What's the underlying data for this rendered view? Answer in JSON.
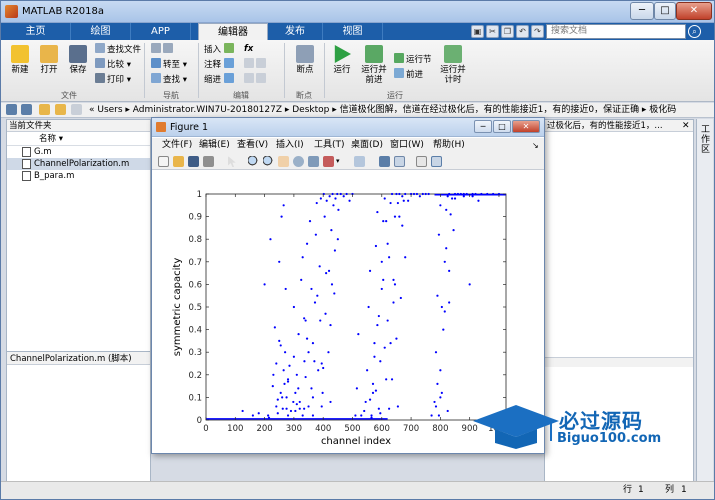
{
  "window": {
    "title": "MATLAB R2018a",
    "min": "─",
    "max": "□",
    "close": "✕"
  },
  "tabs": [
    "主页",
    "绘图",
    "APP",
    "编辑器",
    "发布",
    "视图"
  ],
  "active_tab": "编辑器",
  "search": {
    "placeholder": "搜索文档"
  },
  "ribbon": {
    "file": {
      "new": "新建",
      "open": "打开",
      "save": "保存",
      "find_files": "查找文件",
      "compare": "比较",
      "print": "打印",
      "section": "文件"
    },
    "nav": {
      "goto": "转至",
      "find": "查找",
      "section": "导航"
    },
    "edit": {
      "insert": "插入",
      "comment": "注释",
      "indent": "缩进",
      "fx": "fx",
      "section": "编辑"
    },
    "breakpoints": {
      "label": "断点",
      "section": "断点"
    },
    "run": {
      "run": "运行",
      "run_advance": "运行并前进",
      "run_section": "运行节",
      "advance": "前进",
      "run_time": "运行并计时",
      "section": "运行"
    }
  },
  "address": {
    "path": "« Users ▸ Administrator.WIN7U-20180127Z ▸ Desktop ▸ 信道极化图解，信道在经过极化后，有的性能接近1，有的接近0，保证正确 ▸ 极化码"
  },
  "current_folder": {
    "title": "当前文件夹",
    "name_column": "名称 ▾",
    "files": [
      "G.m",
      "ChannelPolarization.m",
      "B_para.m"
    ],
    "selected": "ChannelPolarization.m",
    "details": "ChannelPolarization.m  (脚本)"
  },
  "editor_tab_text": "过极化后，有的性能接近1，...",
  "workspace_label": "工作区",
  "status": {
    "row_label": "行",
    "row": "1",
    "col_label": "列",
    "col": "1"
  },
  "figure": {
    "title": "Figure 1",
    "menu": [
      "文件(F)",
      "编辑(E)",
      "查看(V)",
      "插入(I)",
      "工具(T)",
      "桌面(D)",
      "窗口(W)",
      "帮助(H)"
    ]
  },
  "chart_data": {
    "type": "scatter",
    "title": "",
    "xlabel": "channel index",
    "ylabel": "symmetric capacity",
    "xlim": [
      0,
      1024
    ],
    "ylim": [
      0,
      1
    ],
    "xticks": [
      0,
      100,
      200,
      300,
      400,
      500,
      600,
      700,
      800,
      900,
      1000
    ],
    "yticks": [
      0,
      0.1,
      0.2,
      0.3,
      0.4,
      0.5,
      0.6,
      0.7,
      0.8,
      0.9,
      1
    ],
    "marker_color": "#0000ff",
    "grid": false,
    "series": [
      {
        "x": [
          125,
          160,
          180,
          200,
          212,
          220,
          228,
          235,
          240,
          245,
          250,
          255,
          258,
          262,
          265,
          268,
          272,
          275,
          280,
          290,
          298,
          305,
          310,
          316,
          320,
          325,
          330,
          336,
          340,
          345,
          350,
          355,
          360,
          365,
          372,
          378,
          383,
          388,
          392,
          398,
          402,
          408,
          412,
          418,
          422,
          428,
          432,
          438,
          442,
          448,
          452,
          460,
          470,
          480,
          490,
          500,
          510,
          515,
          520,
          530,
          540,
          545,
          550,
          555,
          560,
          565,
          570,
          575,
          580,
          585,
          590,
          595,
          600,
          605,
          610,
          615,
          620,
          625,
          630,
          635,
          640,
          645,
          650,
          655,
          660,
          670,
          680,
          690,
          700,
          710,
          720,
          730,
          740,
          750,
          760,
          770,
          780,
          785,
          790,
          795,
          800,
          805,
          810,
          815,
          820,
          825,
          830,
          840,
          850,
          860,
          870,
          880,
          890,
          900,
          910,
          920,
          940,
          960,
          980,
          1000,
          230,
          250,
          265,
          280,
          300,
          320,
          335,
          350,
          365,
          380,
          395,
          410,
          425,
          440,
          560,
          575,
          590,
          605,
          620,
          635,
          650,
          665,
          680,
          785,
          800,
          815,
          830,
          845,
          255,
          270,
          285,
          300,
          315,
          330,
          345,
          360,
          375,
          390,
          405,
          420,
          435,
          450,
          570,
          585,
          600,
          615,
          630,
          645,
          660,
          675,
          790,
          805,
          820,
          835,
          850,
          880,
          240,
          260,
          280,
          310,
          340,
          370,
          400,
          430,
          580,
          610,
          640,
          670,
          800,
          830,
          910,
          215,
          245,
          275,
          305,
          335,
          365,
          395,
          425,
          565,
          595,
          625,
          655,
          795,
          825,
          930
        ],
        "y": [
          0.04,
          0.02,
          0.03,
          0.6,
          0.02,
          0.8,
          0.15,
          0.41,
          0.25,
          0.09,
          0.7,
          0.33,
          0.9,
          0.05,
          0.95,
          0.16,
          0.58,
          0.1,
          0.02,
          0.04,
          0.08,
          0.12,
          0.2,
          0.38,
          0.05,
          0.62,
          0.02,
          0.26,
          0.44,
          0.78,
          0.06,
          0.88,
          0.14,
          0.34,
          0.52,
          0.96,
          0.22,
          0.68,
          0.98,
          0.12,
          1,
          0.47,
          0.97,
          0.3,
          0.99,
          0.84,
          1,
          0.56,
          0.98,
          1,
          0.93,
          1,
          0.99,
          1,
          0.97,
          1,
          0.02,
          0.14,
          0.38,
          0.02,
          0.04,
          0.08,
          0.22,
          0.5,
          0.66,
          0.02,
          0.12,
          0.34,
          0.77,
          0.92,
          0.05,
          0.26,
          0.58,
          0.88,
          0.98,
          0.18,
          0.44,
          0.72,
          0.96,
          1,
          0.62,
          0.9,
          1,
          0.96,
          1,
          0.99,
          1,
          0.97,
          1,
          1,
          1,
          0.99,
          1,
          1,
          1,
          0.02,
          0.08,
          0.3,
          0.55,
          0.82,
          0.95,
          0.12,
          0.4,
          0.7,
          0.93,
          0.99,
          1,
          0.98,
          1,
          1,
          1,
          1,
          1,
          0.6,
          1,
          1,
          1,
          1,
          1,
          1,
          0.2,
          0.35,
          0.22,
          0.18,
          0.28,
          0.08,
          0.45,
          0.3,
          0.1,
          0.55,
          0.25,
          0.65,
          0.42,
          0.75,
          0.09,
          0.28,
          0.46,
          0.62,
          0.78,
          0.18,
          0.36,
          0.54,
          0.72,
          0.06,
          0.22,
          0.48,
          0.66,
          0.84,
          0.12,
          0.3,
          0.24,
          0.5,
          0.14,
          0.72,
          0.36,
          0.58,
          0.82,
          0.44,
          0.9,
          0.66,
          0.95,
          0.8,
          0.16,
          0.42,
          0.7,
          0.88,
          0.34,
          0.6,
          0.9,
          0.97,
          0.16,
          0.5,
          0.76,
          0.91,
          0.98,
          0.99,
          0.06,
          0.1,
          0.17,
          0.07,
          0.19,
          0.26,
          0.23,
          0.6,
          0.13,
          0.32,
          0.52,
          0.86,
          0.1,
          0.52,
          0.99,
          0.01,
          0.03,
          0.05,
          0.04,
          0.05,
          0.02,
          0.06,
          0.08,
          0.01,
          0.03,
          0.05,
          0.06,
          0.02,
          0.04,
          0.97
        ]
      }
    ]
  },
  "watermark": {
    "text": "必过源码",
    "sub": "Biguo100.com"
  }
}
